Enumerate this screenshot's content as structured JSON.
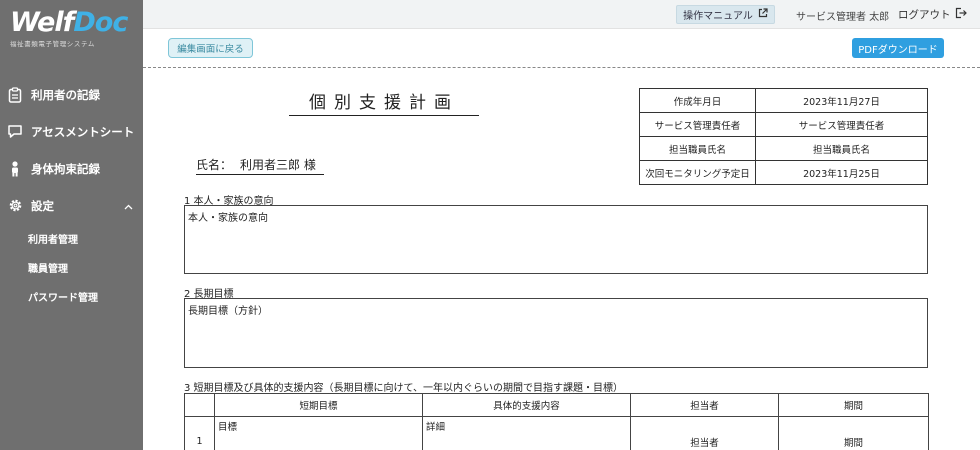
{
  "sidebar": {
    "logo_main_1": "Welf",
    "logo_main_2": "Doc",
    "logo_sub": "福祉書類電子管理システム",
    "nav": [
      {
        "label": "利用者の記録",
        "icon": "clipboard-icon"
      },
      {
        "label": "アセスメントシート",
        "icon": "chat-icon"
      },
      {
        "label": "身体拘束記録",
        "icon": "person-icon"
      },
      {
        "label": "設定",
        "icon": "gear-icon"
      }
    ],
    "sub_items": [
      "利用者管理",
      "職員管理",
      "パスワード管理"
    ]
  },
  "header": {
    "manual_label": "操作マニュアル",
    "admin_name": "サービス管理者 太郎",
    "logout_label": "ログアウト"
  },
  "toolbar": {
    "back_label": "編集画面に戻る",
    "pdf_label": "PDFダウンロード"
  },
  "document": {
    "title": "個別支援計画",
    "name_label": "氏名：",
    "name_value": "利用者三郎 様",
    "info": [
      {
        "key": "作成年月日",
        "value": "2023年11月27日"
      },
      {
        "key": "サービス管理責任者",
        "value": "サービス管理責任者"
      },
      {
        "key": "担当職員氏名",
        "value": "担当職員氏名"
      },
      {
        "key": "次回モニタリング予定日",
        "value": "2023年11月25日"
      }
    ],
    "section1_label": "1 本人・家族の意向",
    "section1_text": "本人・家族の意向",
    "section2_label": "2 長期目標",
    "section2_text": "長期目標（方針）",
    "section3_label": "3 短期目標及び具体的支援内容（長期目標に向けて、一年以内ぐらいの期間で目指す課題・目標）",
    "plan_headers": [
      "短期目標",
      "具体的支援内容",
      "担当者",
      "期間"
    ],
    "plan_rows": [
      {
        "num": "1",
        "goal": "目標",
        "detail": "詳細",
        "staff": "担当者",
        "period": "期間"
      }
    ]
  }
}
